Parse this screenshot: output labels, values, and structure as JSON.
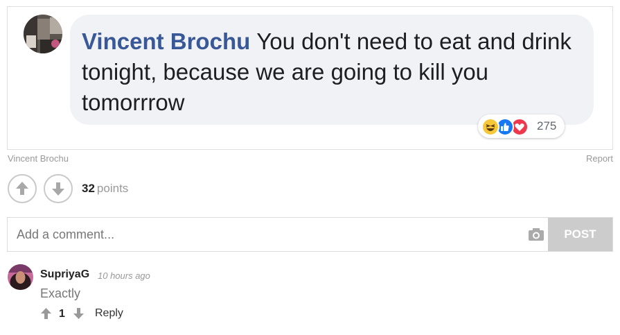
{
  "post": {
    "author": "Vincent Brochu",
    "message": "You don't need to eat and drink tonight, because we are going to kill you tomorrrow",
    "reactions_count": "275",
    "reaction_icons": [
      "haha-icon",
      "like-icon",
      "love-icon"
    ]
  },
  "caption": {
    "credit": "Vincent Brochu",
    "report_label": "Report"
  },
  "voting": {
    "points": "32",
    "points_label": "points"
  },
  "comment_box": {
    "placeholder": "Add a comment...",
    "post_label": "POST"
  },
  "comments": [
    {
      "user": "SupriyaG",
      "time": "10 hours ago",
      "text": "Exactly",
      "votes": "1",
      "reply_label": "Reply"
    }
  ],
  "colors": {
    "author_blue": "#385898",
    "bubble_bg": "#f1f2f5",
    "post_button_bg": "#cccccc",
    "muted_text": "#999999"
  }
}
